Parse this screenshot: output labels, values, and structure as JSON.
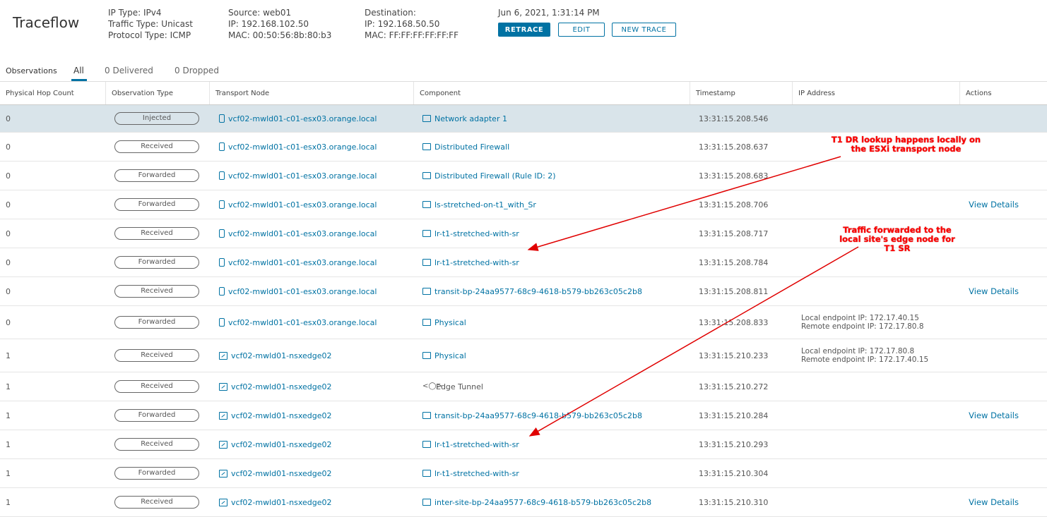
{
  "header": {
    "title": "Traceflow",
    "ip_type": "IP Type: IPv4",
    "traffic_type": "Traffic Type: Unicast",
    "protocol_type": "Protocol Type: ICMP",
    "source_label": "Source: web01",
    "source_ip": "IP: 192.168.102.50",
    "source_mac": "MAC: 00:50:56:8b:80:b3",
    "destination_label": "Destination:",
    "destination_ip": "IP: 192.168.50.50",
    "destination_mac": "MAC: FF:FF:FF:FF:FF:FF",
    "timestamp": "Jun 6, 2021, 1:31:14 PM",
    "retrace_label": "RETRACE",
    "edit_label": "EDIT",
    "new_trace_label": "NEW TRACE"
  },
  "tabs": {
    "observations_label": "Observations",
    "all": "All",
    "delivered": "0 Delivered",
    "dropped": "0 Dropped"
  },
  "columns": [
    "Physical Hop Count",
    "Observation Type",
    "Transport Node",
    "Component",
    "Timestamp",
    "IP Address",
    "Actions"
  ],
  "rows": [
    {
      "hop": "0",
      "type": "Injected",
      "node": "vcf02-mwld01-c01-esx03.orange.local",
      "node_icon": "host-icon",
      "component": "Network adapter 1",
      "comp_icon": "network-adapter-icon",
      "timestamp": "13:31:15.208.546",
      "ip1": "",
      "ip2": "",
      "action": ""
    },
    {
      "hop": "0",
      "type": "Received",
      "node": "vcf02-mwld01-c01-esx03.orange.local",
      "node_icon": "host-icon",
      "component": "Distributed Firewall",
      "comp_icon": "firewall-icon",
      "timestamp": "13:31:15.208.637",
      "ip1": "",
      "ip2": "",
      "action": ""
    },
    {
      "hop": "0",
      "type": "Forwarded",
      "node": "vcf02-mwld01-c01-esx03.orange.local",
      "node_icon": "host-icon",
      "component": "Distributed Firewall (Rule ID: 2)",
      "comp_icon": "firewall-icon",
      "timestamp": "13:31:15.208.683",
      "ip1": "",
      "ip2": "",
      "action": ""
    },
    {
      "hop": "0",
      "type": "Forwarded",
      "node": "vcf02-mwld01-c01-esx03.orange.local",
      "node_icon": "host-icon",
      "component": "ls-stretched-on-t1_with_Sr",
      "comp_icon": "switch-icon",
      "timestamp": "13:31:15.208.706",
      "ip1": "",
      "ip2": "",
      "action": "View Details"
    },
    {
      "hop": "0",
      "type": "Received",
      "node": "vcf02-mwld01-c01-esx03.orange.local",
      "node_icon": "host-icon",
      "component": "lr-t1-stretched-with-sr",
      "comp_icon": "router-icon",
      "timestamp": "13:31:15.208.717",
      "ip1": "",
      "ip2": "",
      "action": ""
    },
    {
      "hop": "0",
      "type": "Forwarded",
      "node": "vcf02-mwld01-c01-esx03.orange.local",
      "node_icon": "host-icon",
      "component": "lr-t1-stretched-with-sr",
      "comp_icon": "router-icon",
      "timestamp": "13:31:15.208.784",
      "ip1": "",
      "ip2": "",
      "action": ""
    },
    {
      "hop": "0",
      "type": "Received",
      "node": "vcf02-mwld01-c01-esx03.orange.local",
      "node_icon": "host-icon",
      "component": "transit-bp-24aa9577-68c9-4618-b579-bb263c05c2b8",
      "comp_icon": "switch-icon",
      "timestamp": "13:31:15.208.811",
      "ip1": "",
      "ip2": "",
      "action": "View Details"
    },
    {
      "hop": "0",
      "type": "Forwarded",
      "node": "vcf02-mwld01-c01-esx03.orange.local",
      "node_icon": "host-icon",
      "component": "Physical",
      "comp_icon": "physical-icon",
      "timestamp": "13:31:15.208.833",
      "ip1": "Local endpoint IP: 172.17.40.15",
      "ip2": "Remote endpoint IP: 172.17.80.8",
      "action": ""
    },
    {
      "hop": "1",
      "type": "Received",
      "node": "vcf02-mwld01-nsxedge02",
      "node_icon": "edge-icon",
      "component": "Physical",
      "comp_icon": "physical-icon",
      "timestamp": "13:31:15.210.233",
      "ip1": "Local endpoint IP: 172.17.80.8",
      "ip2": "Remote endpoint IP: 172.17.40.15",
      "action": ""
    },
    {
      "hop": "1",
      "type": "Received",
      "node": "vcf02-mwld01-nsxedge02",
      "node_icon": "edge-icon",
      "component": "Edge Tunnel",
      "comp_icon": "tunnel-icon",
      "timestamp": "13:31:15.210.272",
      "ip1": "",
      "ip2": "",
      "action": ""
    },
    {
      "hop": "1",
      "type": "Forwarded",
      "node": "vcf02-mwld01-nsxedge02",
      "node_icon": "edge-icon",
      "component": "transit-bp-24aa9577-68c9-4618-b579-bb263c05c2b8",
      "comp_icon": "switch-icon",
      "timestamp": "13:31:15.210.284",
      "ip1": "",
      "ip2": "",
      "action": "View Details"
    },
    {
      "hop": "1",
      "type": "Received",
      "node": "vcf02-mwld01-nsxedge02",
      "node_icon": "edge-icon",
      "component": "lr-t1-stretched-with-sr",
      "comp_icon": "router-icon",
      "timestamp": "13:31:15.210.293",
      "ip1": "",
      "ip2": "",
      "action": ""
    },
    {
      "hop": "1",
      "type": "Forwarded",
      "node": "vcf02-mwld01-nsxedge02",
      "node_icon": "edge-icon",
      "component": "lr-t1-stretched-with-sr",
      "comp_icon": "router-icon",
      "timestamp": "13:31:15.210.304",
      "ip1": "",
      "ip2": "",
      "action": ""
    },
    {
      "hop": "1",
      "type": "Received",
      "node": "vcf02-mwld01-nsxedge02",
      "node_icon": "edge-icon",
      "component": "inter-site-bp-24aa9577-68c9-4618-b579-bb263c05c2b8",
      "comp_icon": "switch-icon",
      "timestamp": "13:31:15.210.310",
      "ip1": "",
      "ip2": "",
      "action": "View Details"
    }
  ],
  "annotations": {
    "note1": "T1 DR lookup happens locally on the ESXi transport node",
    "note2": "Traffic forwarded to the local site's edge node for T1 SR",
    "color": "#ff0000"
  },
  "colors": {
    "accent": "#0072a3",
    "selected_row": "#d9e4ea"
  }
}
